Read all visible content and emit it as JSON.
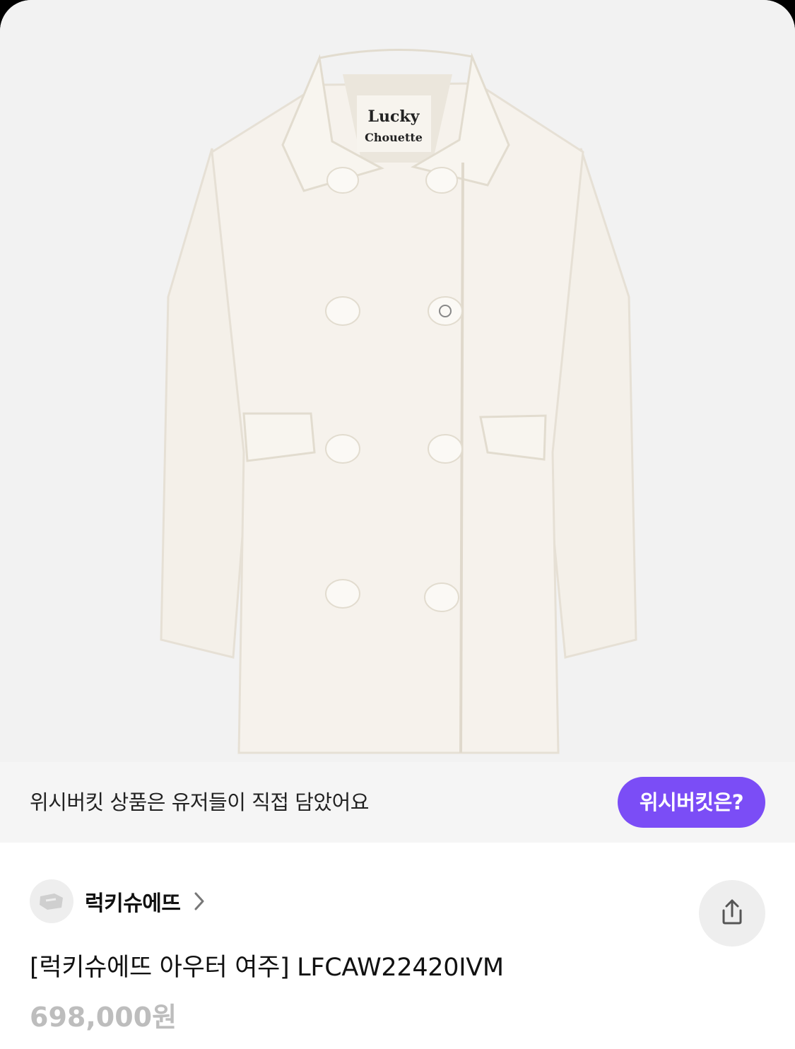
{
  "product_image": {
    "label_line1": "Lucky",
    "label_line2": "Chouette",
    "alt": "coat-photo"
  },
  "wish_banner": {
    "text": "위시버킷 상품은 유저들이 직접 담았어요",
    "button_label": "위시버킷은?"
  },
  "seller": {
    "name": "럭키슈에뜨",
    "avatar_icon": "store-logo-icon",
    "chevron_icon": "chevron-right-icon"
  },
  "share": {
    "icon": "share-icon"
  },
  "product": {
    "title": "[럭키슈에뜨 아우터 여주] LFCAW22420IVM",
    "price": "698,000원"
  },
  "colors": {
    "accent": "#7b4df6",
    "price_gray": "#bdbdbd",
    "coat": "#f5f1ea"
  }
}
